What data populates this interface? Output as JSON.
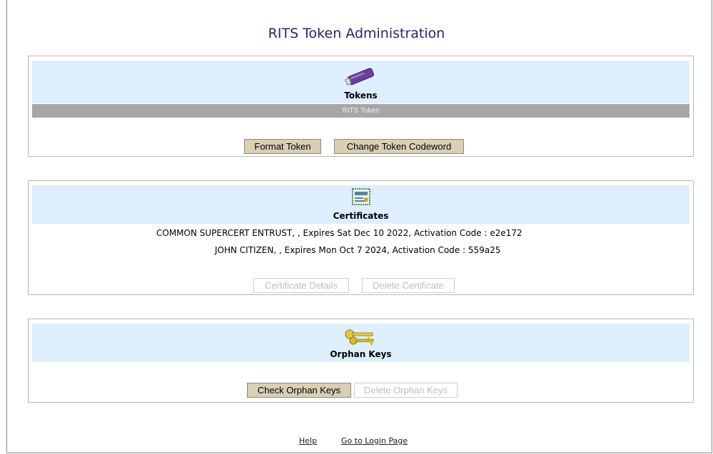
{
  "page": {
    "title": "RITS Token Administration"
  },
  "tokens": {
    "heading": "Tokens",
    "bar_label": "RITS Token",
    "icon": "usb-token-icon",
    "buttons": {
      "format": "Format Token",
      "change_codeword": "Change Token Codeword"
    }
  },
  "certificates": {
    "heading": "Certificates",
    "icon": "certificate-icon",
    "items": [
      "COMMON SUPERCERT ENTRUST, , Expires Sat Dec 10 2022, Activation Code : e2e172",
      "JOHN CITIZEN, , Expires Mon Oct 7 2024, Activation Code : 559a25"
    ],
    "buttons": {
      "details": "Certificate Details",
      "delete": "Delete Certificate"
    }
  },
  "orphan_keys": {
    "heading": "Orphan Keys",
    "icon": "keys-icon",
    "buttons": {
      "check": "Check Orphan Keys",
      "delete": "Delete Orphan Keys"
    }
  },
  "footer": {
    "help": "Help",
    "login": "Go to Login Page"
  },
  "colors": {
    "title": "#1f2a6b",
    "panel_header": "#deeefc",
    "bar": "#a6a6a6",
    "button": "#d9cfb5"
  }
}
